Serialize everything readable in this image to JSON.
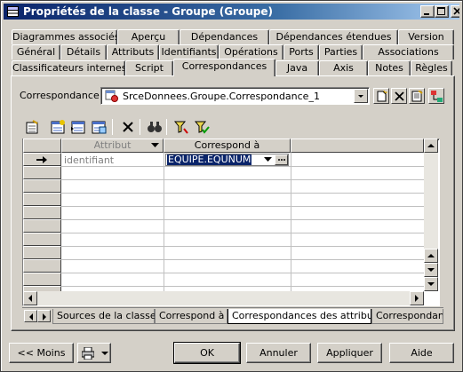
{
  "window": {
    "title": "Propriétés de la classe - Groupe (Groupe)"
  },
  "tabs": {
    "row1": [
      "Diagrammes associés",
      "Aperçu",
      "Dépendances",
      "Dépendances étendues",
      "Version"
    ],
    "row2": [
      "Général",
      "Détails",
      "Attributs",
      "Identifiants",
      "Opérations",
      "Ports",
      "Parties",
      "Associations"
    ],
    "row3": [
      "Classificateurs internes",
      "Script",
      "Correspondances",
      "Java",
      "Axis",
      "Notes",
      "Règles"
    ],
    "active": "Correspondances"
  },
  "mapping": {
    "label": "Correspondance :",
    "value": "SrceDonnees.Groupe.Correspondance_1"
  },
  "grid": {
    "headers": {
      "attribute": "Attribut",
      "maps_to": "Correspond à"
    },
    "rows": [
      {
        "attribute": "identifiant",
        "maps_to": "EQUIPE.EQUNUM"
      }
    ]
  },
  "bottom_tabs": [
    "Sources de la classe",
    "Correspond à",
    "Correspondances des attributs",
    "Correspondanc"
  ],
  "buttons": {
    "less": "<< Moins",
    "ok": "OK",
    "cancel": "Annuler",
    "apply": "Appliquer",
    "help": "Aide"
  },
  "colors": {
    "title_bar": "#0a246a",
    "selection": "#0a246a",
    "face": "#d4d0c8"
  }
}
